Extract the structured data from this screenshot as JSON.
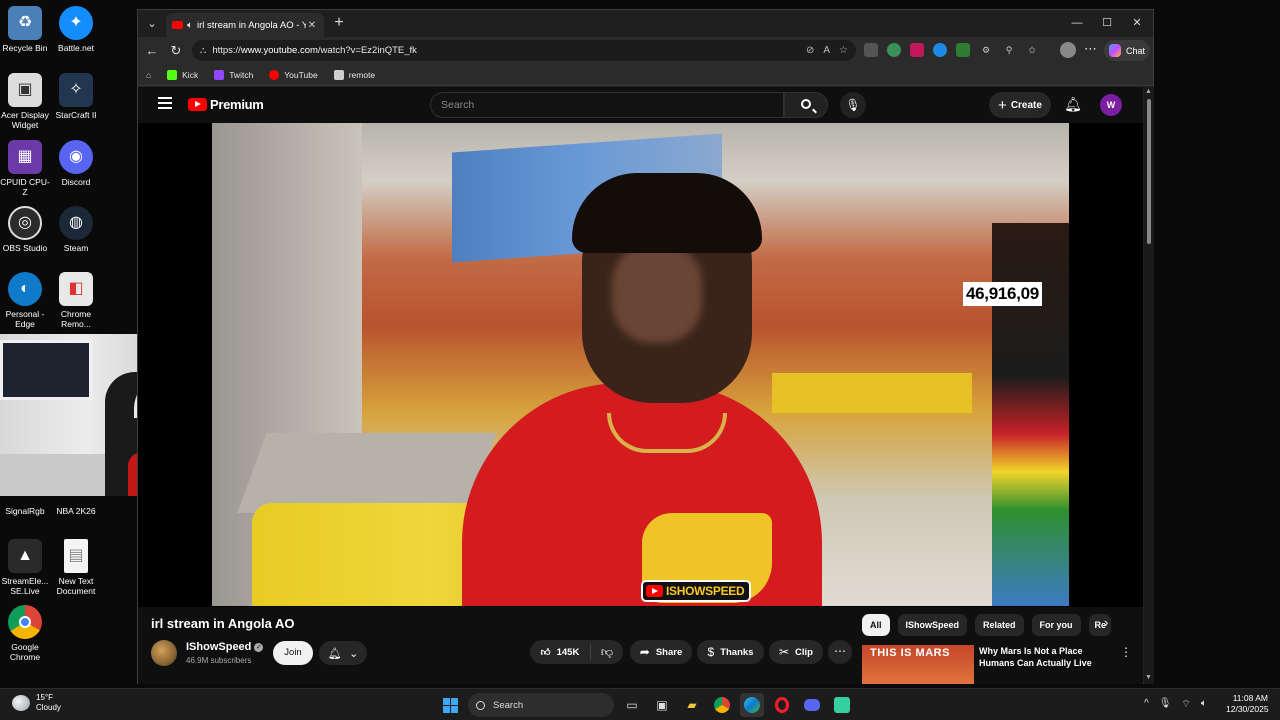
{
  "desktop": {
    "icons": [
      {
        "label": "Recycle Bin",
        "glyph": "♻",
        "color": "#4a7fb8",
        "icon": "recycle-bin-icon"
      },
      {
        "label": "Battle.net",
        "glyph": "✦",
        "color": "#148eff",
        "icon": "battlenet-icon"
      },
      {
        "label": "Acer Display Widget",
        "glyph": "▣",
        "color": "#dcdcdc",
        "icon": "acer-display-icon"
      },
      {
        "label": "StarCraft II",
        "glyph": "✧",
        "color": "#23364f",
        "icon": "starcraft-icon"
      },
      {
        "label": "CPUID CPU-Z",
        "glyph": "▦",
        "color": "#6b3aa8",
        "icon": "cpuz-icon"
      },
      {
        "label": "Discord",
        "glyph": "◉",
        "color": "#5865f2",
        "icon": "discord-icon"
      },
      {
        "label": "OBS Studio",
        "glyph": "◎",
        "color": "#2b2b2b",
        "icon": "obs-icon"
      },
      {
        "label": "Steam",
        "glyph": "◍",
        "color": "#1b2838",
        "icon": "steam-icon"
      },
      {
        "label": "Personal - Edge",
        "glyph": "◐",
        "color": "#0f7ac8",
        "icon": "edge-icon"
      },
      {
        "label": "Chrome Remo...",
        "glyph": "◧",
        "color": "#e8e8e8",
        "icon": "chrome-remote-icon"
      },
      {
        "label": "SignalRgb",
        "glyph": "◆",
        "color": "#5a2a8a",
        "icon": "signalrgb-icon"
      },
      {
        "label": "NBA 2K26",
        "glyph": "■",
        "color": "#c21c1c",
        "icon": "nba2k-icon"
      },
      {
        "label": "StreamEle... SE.Live",
        "glyph": "▲",
        "color": "#2a2a2a",
        "icon": "streamelements-icon"
      },
      {
        "label": "New Text Document",
        "glyph": "▤",
        "color": "#f4f4f4",
        "icon": "text-document-icon"
      },
      {
        "label": "Google Chrome",
        "glyph": "◉",
        "color": "#e8e8e8",
        "icon": "chrome-icon"
      }
    ]
  },
  "browser": {
    "tab_title": "irl stream in Angola AO - YouT",
    "url_prefix": "https://",
    "url_host": "www.youtube.com",
    "url_path": "/watch?v=Ez2inQTE_fk",
    "chat_label": "Chat",
    "bookmarks": [
      {
        "label": "Kick",
        "color": "#53fc18"
      },
      {
        "label": "Twitch",
        "color": "#9146ff"
      },
      {
        "label": "YouTube",
        "color": "#ff0000"
      },
      {
        "label": "remote",
        "color": "#cfcfcf"
      }
    ]
  },
  "youtube": {
    "logo_text": "Premium",
    "search_placeholder": "Search",
    "create_label": "Create",
    "avatar_letter": "W",
    "counter_overlay": "46,916,09",
    "watermark": "ISHOWSPEED",
    "video_title": "irl stream in Angola AO",
    "channel_name": "IShowSpeed",
    "subscribers": "46.9M subscribers",
    "join_label": "Join",
    "likes": "145K",
    "share_label": "Share",
    "thanks_label": "Thanks",
    "clip_label": "Clip",
    "chips": [
      "All",
      "IShowSpeed",
      "Related",
      "For you",
      "Re"
    ],
    "rec": {
      "thumb_text": "THIS IS MARS",
      "title": "Why Mars Is Not a Place Humans Can Actually Live"
    }
  },
  "taskbar": {
    "temp": "15°F",
    "condition": "Cloudy",
    "search_label": "Search",
    "time": "11:08 AM",
    "date": "12/30/2025"
  }
}
